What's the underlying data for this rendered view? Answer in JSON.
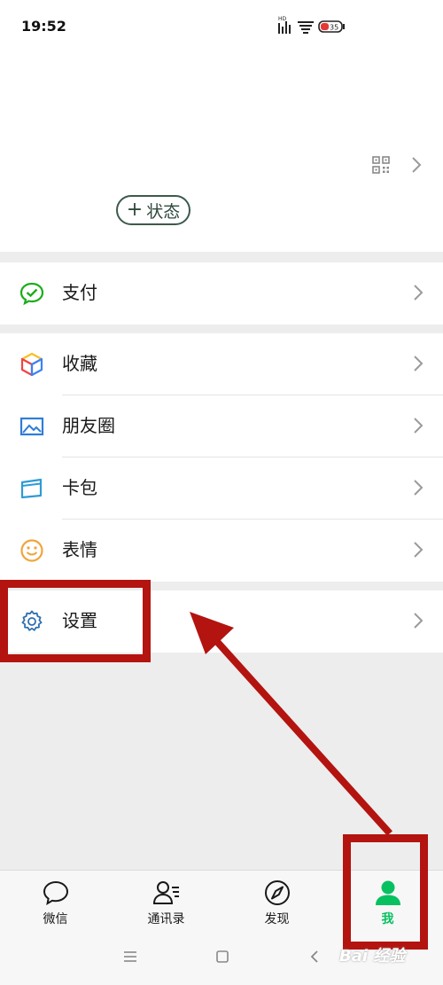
{
  "status_bar": {
    "time": "19:52",
    "battery": "35",
    "hd_label": "HD"
  },
  "profile": {
    "status_button": "状态",
    "status_plus": "+"
  },
  "menu": {
    "pay": {
      "label": "支付",
      "icon": "wechat-pay-icon"
    },
    "favorites": {
      "label": "收藏",
      "icon": "cube-icon"
    },
    "moments": {
      "label": "朋友圈",
      "icon": "image-icon"
    },
    "cards": {
      "label": "卡包",
      "icon": "card-icon"
    },
    "stickers": {
      "label": "表情",
      "icon": "smiley-icon"
    },
    "settings": {
      "label": "设置",
      "icon": "gear-icon"
    }
  },
  "tabbar": {
    "chats": "微信",
    "contacts": "通讯录",
    "discover": "发现",
    "me": "我"
  },
  "watermark": "Bai 经验",
  "colors": {
    "accent": "#07c160",
    "annotation": "#b3140f",
    "background": "#ededed"
  }
}
